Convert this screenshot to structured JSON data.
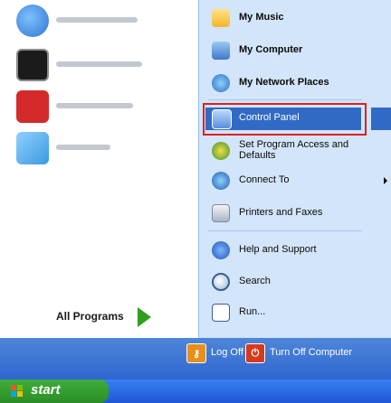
{
  "left_pane": {
    "recent_programs": [
      {
        "icon": "windows-update-icon",
        "color": "#2f74d0"
      },
      {
        "icon": "command-prompt-icon",
        "color": "#1b1b1b"
      },
      {
        "icon": "adobe-reader-icon",
        "color": "#d42a2a"
      },
      {
        "icon": "notepad-icon",
        "color": "#3a9adf"
      }
    ],
    "all_programs_label": "All Programs"
  },
  "right_pane": {
    "items": [
      {
        "label": "My Music",
        "icon": "music-folder-icon",
        "bold": true
      },
      {
        "label": "My Computer",
        "icon": "computer-icon",
        "bold": true
      },
      {
        "label": "My Network Places",
        "icon": "network-places-icon",
        "bold": true
      },
      {
        "label": "Control Panel",
        "icon": "control-panel-icon",
        "selected": true
      },
      {
        "label": "Set Program Access and Defaults",
        "icon": "program-access-icon"
      },
      {
        "label": "Connect To",
        "icon": "connect-to-icon"
      },
      {
        "label": "Printers and Faxes",
        "icon": "printer-icon"
      },
      {
        "label": "Help and Support",
        "icon": "help-icon"
      },
      {
        "label": "Search",
        "icon": "search-icon"
      },
      {
        "label": "Run...",
        "icon": "run-icon"
      }
    ]
  },
  "footer": {
    "logoff_label": "Log Off",
    "turnoff_label": "Turn Off Computer"
  },
  "taskbar": {
    "start_label": "start"
  },
  "colors": {
    "selection": "#316ac5",
    "highlight_box": "#e02020",
    "right_pane_bg": "#d3e5fa",
    "footer": "#2e66cf",
    "start_green": "#2b8d26"
  }
}
